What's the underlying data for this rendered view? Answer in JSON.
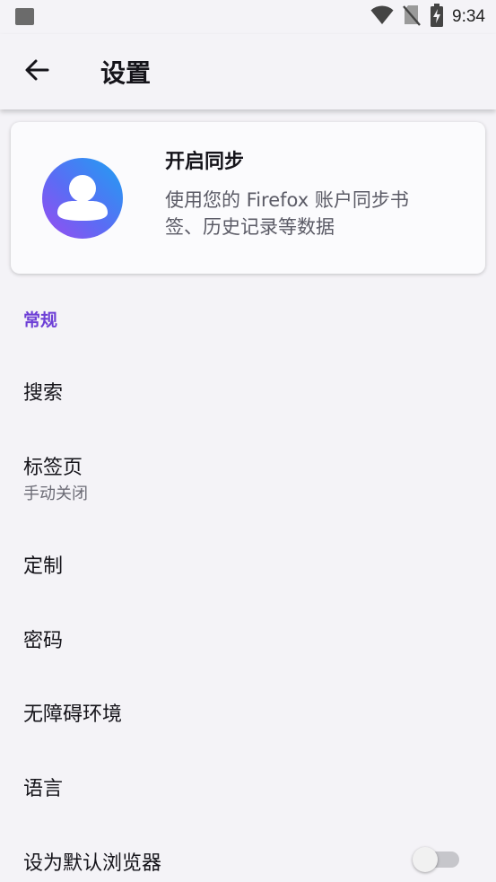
{
  "status_bar": {
    "time": "9:34",
    "icons": [
      "notification-square-icon",
      "wifi-icon",
      "no-sim-icon",
      "battery-charging-icon"
    ]
  },
  "app_bar": {
    "back_icon": "arrow-left-icon",
    "title": "设置"
  },
  "sync_card": {
    "icon": "account-avatar-icon",
    "title": "开启同步",
    "description_line1": "使用您的 Firefox 账户同步书",
    "description_line2": "签、历史记录等数据"
  },
  "section": {
    "header": "常规"
  },
  "items": {
    "search": {
      "title": "搜索"
    },
    "tabs": {
      "title": "标签页",
      "summary": "手动关闭"
    },
    "customize": {
      "title": "定制"
    },
    "passwords": {
      "title": "密码"
    },
    "accessibility": {
      "title": "无障碍环境"
    },
    "language": {
      "title": "语言"
    },
    "default_browser": {
      "title": "设为默认浏览器",
      "toggle_on": false
    }
  },
  "colors": {
    "accent": "#6d3fd6",
    "background": "#f4f3f7",
    "avatar_gradient": [
      "#1fa0f2",
      "#9059ff"
    ]
  }
}
